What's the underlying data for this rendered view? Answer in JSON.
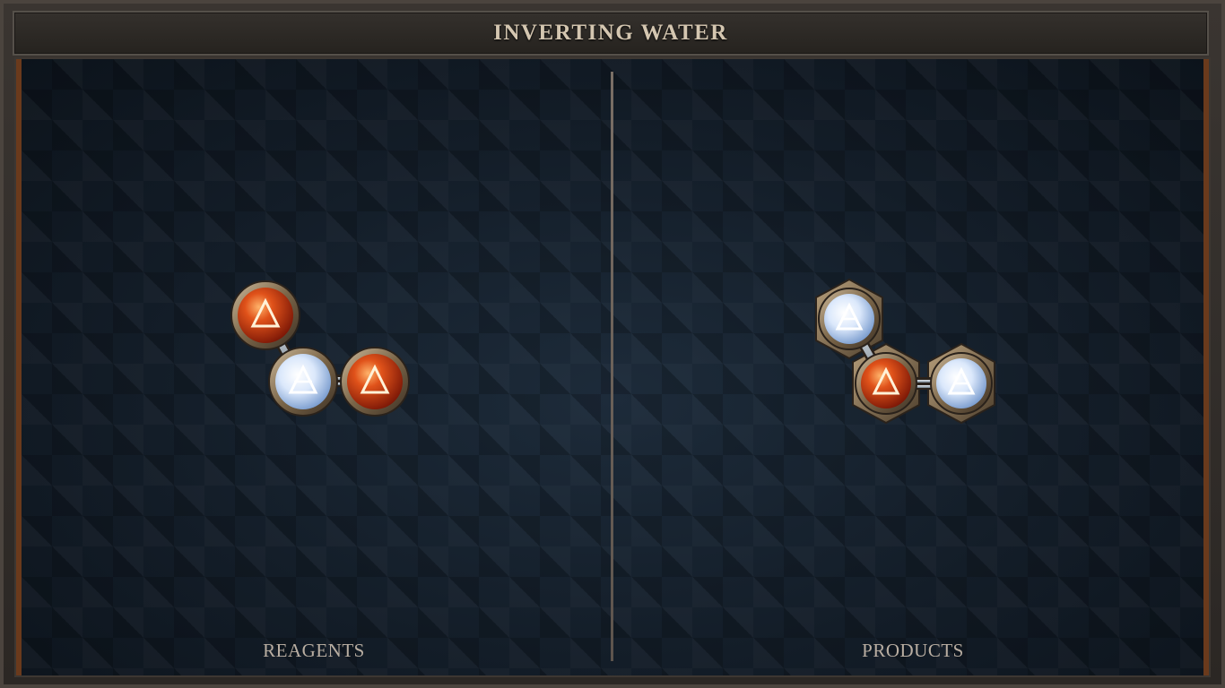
{
  "title": "INVERTING WATER",
  "panels": {
    "reagents_label": "REAGENTS",
    "products_label": "PRODUCTS"
  },
  "colors": {
    "fire_core": "#e0521a",
    "fire_edge": "#8a1c08",
    "air_core": "#e8f2ff",
    "air_edge": "#6d92c8",
    "frame_bronze": "#9d8769",
    "board_bg": "#131d28",
    "side_trim": "#6a3a1c"
  },
  "reagents": {
    "atoms": [
      {
        "element": "fire",
        "icon": "fire-triangle-icon"
      },
      {
        "element": "air",
        "icon": "air-triangle-icon"
      },
      {
        "element": "fire",
        "icon": "fire-triangle-icon"
      }
    ]
  },
  "products": {
    "atoms": [
      {
        "element": "air",
        "icon": "air-triangle-icon",
        "frame": "hexagon"
      },
      {
        "element": "fire",
        "icon": "fire-triangle-icon",
        "frame": "hexagon"
      },
      {
        "element": "air",
        "icon": "air-triangle-icon",
        "frame": "hexagon"
      }
    ]
  }
}
